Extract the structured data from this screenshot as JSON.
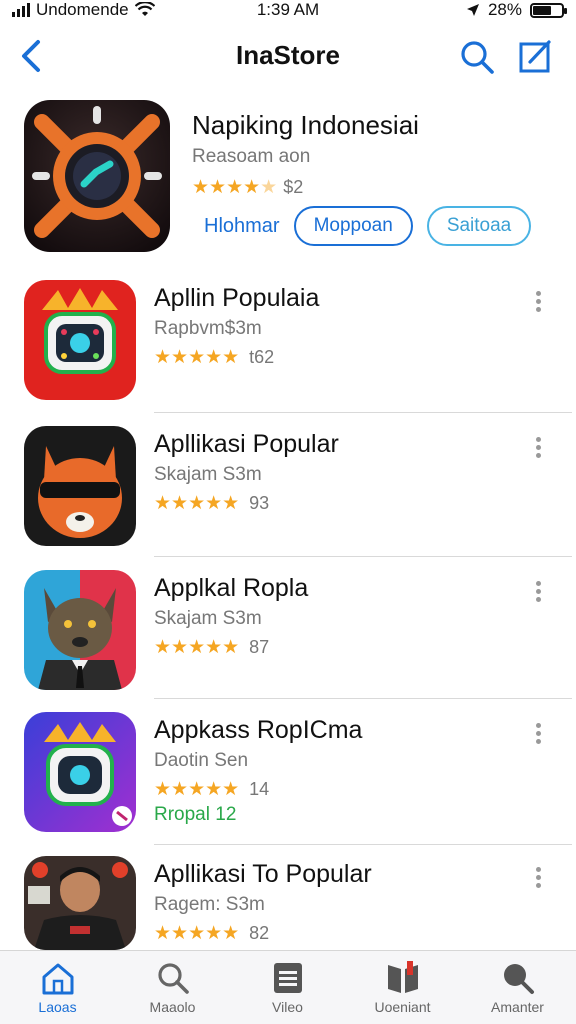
{
  "status_bar": {
    "carrier": "Undomende",
    "time": "1:39 AM",
    "battery": "28%",
    "icons": [
      "signal-icon",
      "wifi-icon",
      "location-icon",
      "battery-icon"
    ]
  },
  "nav": {
    "title": "InaStore",
    "icons": [
      "back-chevron-icon",
      "search-icon",
      "compose-icon"
    ]
  },
  "featured": {
    "title": "Napiking Indonesiai",
    "subtitle": "Reasoam aon",
    "rating_value": "$2",
    "stars": 4,
    "link_label": "Hlohmar",
    "primary_button": "Moppoan",
    "secondary_button": "Saitoaa"
  },
  "apps": [
    {
      "title": "Apllin Populaia",
      "subtitle": "Rapbvm$3m",
      "rating_value": "t62",
      "extra": ""
    },
    {
      "title": "Apllikasi Popular",
      "subtitle": "Skajam S3m",
      "rating_value": "93",
      "extra": ""
    },
    {
      "title": "Applkal Ropla",
      "subtitle": "Skajam S3m",
      "rating_value": "87",
      "extra": ""
    },
    {
      "title": "Appkass RopICma",
      "subtitle": "Daotin Sen",
      "rating_value": "14",
      "extra": "Rropal 12"
    },
    {
      "title": "Apllikasi To Popular",
      "subtitle": "Ragem: S3m",
      "rating_value": "82",
      "extra": ""
    }
  ],
  "tabs": [
    {
      "label": "Laoas",
      "icon": "home-icon",
      "active": true
    },
    {
      "label": "Maaolo",
      "icon": "search-icon",
      "active": false
    },
    {
      "label": "Vileo",
      "icon": "list-icon",
      "active": false
    },
    {
      "label": "Uoeniant",
      "icon": "book-icon",
      "active": false
    },
    {
      "label": "Amanter",
      "icon": "search-icon",
      "active": false
    }
  ],
  "colors": {
    "accent": "#1a6fd6",
    "star": "#f5a623",
    "green_text": "#2aa84a"
  }
}
